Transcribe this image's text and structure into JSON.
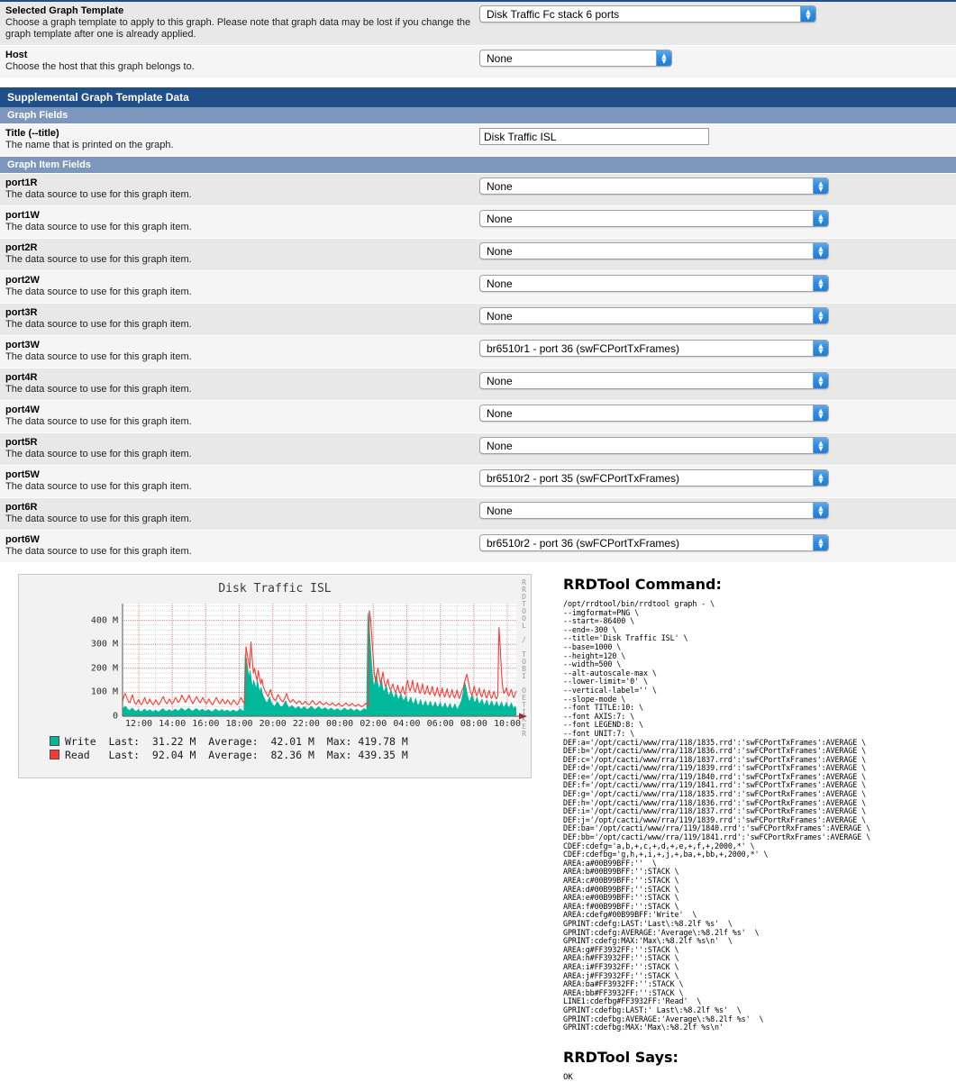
{
  "form": {
    "selected_template": {
      "name": "Selected Graph Template",
      "desc": "Choose a graph template to apply to this graph. Please note that graph data may be lost if you change the graph template after one is already applied.",
      "value": "Disk Traffic Fc stack 6 ports"
    },
    "host": {
      "name": "Host",
      "desc": "Choose the host that this graph belongs to.",
      "value": "None"
    }
  },
  "sections": {
    "supplemental": "Supplemental Graph Template Data",
    "graph_fields": "Graph Fields",
    "graph_item_fields": "Graph Item Fields"
  },
  "title_field": {
    "name": "Title (--title)",
    "desc": "The name that is printed on the graph.",
    "value": "Disk Traffic ISL"
  },
  "item_desc": "The data source to use for this graph item.",
  "items": [
    {
      "name": "port1R",
      "value": "None"
    },
    {
      "name": "port1W",
      "value": "None"
    },
    {
      "name": "port2R",
      "value": "None"
    },
    {
      "name": "port2W",
      "value": "None"
    },
    {
      "name": "port3R",
      "value": "None"
    },
    {
      "name": "port3W",
      "value": "br6510r1 - port 36 (swFCPortTxFrames)"
    },
    {
      "name": "port4R",
      "value": "None"
    },
    {
      "name": "port4W",
      "value": "None"
    },
    {
      "name": "port5R",
      "value": "None"
    },
    {
      "name": "port5W",
      "value": "br6510r2 - port 35 (swFCPortTxFrames)"
    },
    {
      "name": "port6R",
      "value": "None"
    },
    {
      "name": "port6W",
      "value": "br6510r2 - port 36 (swFCPortTxFrames)"
    }
  ],
  "rrdtool": {
    "command_heading": "RRDTool Command:",
    "says_heading": "RRDTool Says:",
    "says_body": "OK",
    "command": "/opt/rrdtool/bin/rrdtool graph - \\\n--imgformat=PNG \\\n--start=-86400 \\\n--end=-300 \\\n--title='Disk Traffic ISL' \\\n--base=1000 \\\n--height=120 \\\n--width=500 \\\n--alt-autoscale-max \\\n--lower-limit='0' \\\n--vertical-label='' \\\n--slope-mode \\\n--font TITLE:10: \\\n--font AXIS:7: \\\n--font LEGEND:8: \\\n--font UNIT:7: \\\nDEF:a='/opt/cacti/www/rra/118/1835.rrd':'swFCPortTxFrames':AVERAGE \\\nDEF:b='/opt/cacti/www/rra/118/1836.rrd':'swFCPortTxFrames':AVERAGE \\\nDEF:c='/opt/cacti/www/rra/118/1837.rrd':'swFCPortTxFrames':AVERAGE \\\nDEF:d='/opt/cacti/www/rra/119/1839.rrd':'swFCPortTxFrames':AVERAGE \\\nDEF:e='/opt/cacti/www/rra/119/1840.rrd':'swFCPortTxFrames':AVERAGE \\\nDEF:f='/opt/cacti/www/rra/119/1841.rrd':'swFCPortTxFrames':AVERAGE \\\nDEF:g='/opt/cacti/www/rra/118/1835.rrd':'swFCPortRxFrames':AVERAGE \\\nDEF:h='/opt/cacti/www/rra/118/1836.rrd':'swFCPortRxFrames':AVERAGE \\\nDEF:i='/opt/cacti/www/rra/118/1837.rrd':'swFCPortRxFrames':AVERAGE \\\nDEF:j='/opt/cacti/www/rra/119/1839.rrd':'swFCPortRxFrames':AVERAGE \\\nDEF:ba='/opt/cacti/www/rra/119/1840.rrd':'swFCPortRxFrames':AVERAGE \\\nDEF:bb='/opt/cacti/www/rra/119/1841.rrd':'swFCPortRxFrames':AVERAGE \\\nCDEF:cdefg='a,b,+,c,+,d,+,e,+,f,+,2000,*' \\\nCDEF:cdefbg='g,h,+,i,+,j,+,ba,+,bb,+,2000,*' \\\nAREA:a#00B99BFF:''  \\\nAREA:b#00B99BFF:'':STACK \\\nAREA:c#00B99BFF:'':STACK \\\nAREA:d#00B99BFF:'':STACK \\\nAREA:e#00B99BFF:'':STACK \\\nAREA:f#00B99BFF:'':STACK \\\nAREA:cdefg#00B99BFF:'Write'  \\\nGPRINT:cdefg:LAST:'Last\\:%8.2lf %s'  \\\nGPRINT:cdefg:AVERAGE:'Average\\:%8.2lf %s'  \\\nGPRINT:cdefg:MAX:'Max\\:%8.2lf %s\\n'  \\\nAREA:g#FF3932FF:'':STACK \\\nAREA:h#FF3932FF:'':STACK \\\nAREA:i#FF3932FF:'':STACK \\\nAREA:j#FF3932FF:'':STACK \\\nAREA:ba#FF3932FF:'':STACK \\\nAREA:bb#FF3932FF:'':STACK \\\nLINE1:cdefbg#FF3932FF:'Read'  \\\nGPRINT:cdefbg:LAST:' Last\\:%8.2lf %s'  \\\nGPRINT:cdefbg:AVERAGE:'Average\\:%8.2lf %s'  \\\nGPRINT:cdefbg:MAX:'Max\\:%8.2lf %s\\n'"
  },
  "chart_data": {
    "type": "area",
    "title": "Disk Traffic ISL",
    "xlabel": "",
    "ylabel": "",
    "watermark": "RRDTOOL / TOBI OETIKER",
    "grid": true,
    "legend_position": "bottom",
    "ylim": [
      0,
      470000000
    ],
    "yticks": [
      0,
      100000000,
      200000000,
      300000000,
      400000000
    ],
    "ytick_labels": [
      "0",
      "100 M",
      "200 M",
      "300 M",
      "400 M"
    ],
    "xtick_labels": [
      "12:00",
      "14:00",
      "16:00",
      "18:00",
      "20:00",
      "22:00",
      "00:00",
      "02:00",
      "04:00",
      "06:00",
      "08:00",
      "10:00"
    ],
    "legend": [
      {
        "name": "Write",
        "color": "#00B99B",
        "last_label": "Last:",
        "last": "31.22 M",
        "average_label": "Average:",
        "average": "42.01 M",
        "max_label": "Max:",
        "max": "419.78 M"
      },
      {
        "name": "Read",
        "color": "#FF3932",
        "last_label": "Last:",
        "last": "92.04 M",
        "average_label": "Average:",
        "average": "82.36 M",
        "max_label": "Max:",
        "max": "439.35 M"
      }
    ],
    "series": [
      {
        "name": "Write",
        "color": "#00B99B",
        "fill": true,
        "values": [
          28,
          35,
          42,
          38,
          30,
          26,
          24,
          30,
          34,
          28,
          22,
          20,
          24,
          28,
          22,
          18,
          20,
          26,
          30,
          24,
          20,
          22,
          28,
          24,
          20,
          18,
          22,
          26,
          22,
          18,
          20,
          24,
          28,
          32,
          26,
          22,
          20,
          24,
          28,
          24,
          20,
          22,
          26,
          30,
          26,
          22,
          24,
          28,
          34,
          30,
          26,
          22,
          26,
          30,
          34,
          28,
          24,
          20,
          24,
          28,
          32,
          28,
          24,
          22,
          26,
          30,
          26,
          22,
          20,
          24,
          28,
          24,
          20,
          18,
          22,
          26,
          30,
          26,
          22,
          20,
          24,
          28,
          24,
          20,
          22,
          26,
          24,
          20,
          18,
          22,
          26,
          24,
          20,
          18,
          22,
          26,
          30,
          26,
          22,
          20,
          260,
          240,
          200,
          160,
          190,
          150,
          120,
          150,
          130,
          110,
          150,
          120,
          100,
          120,
          95,
          80,
          70,
          60,
          55,
          70,
          80,
          60,
          50,
          45,
          40,
          50,
          60,
          55,
          45,
          40,
          38,
          45,
          55,
          65,
          50,
          40,
          35,
          40,
          45,
          40,
          35,
          30,
          35,
          40,
          38,
          32,
          30,
          35,
          40,
          35,
          30,
          28,
          32,
          38,
          42,
          36,
          30,
          28,
          32,
          36,
          40,
          34,
          30,
          28,
          32,
          36,
          32,
          28,
          26,
          30,
          34,
          30,
          26,
          24,
          28,
          32,
          28,
          24,
          22,
          26,
          30,
          34,
          30,
          26,
          24,
          28,
          32,
          28,
          24,
          22,
          26,
          30,
          26,
          22,
          20,
          24,
          28,
          32,
          28,
          24,
          430,
          380,
          300,
          220,
          150,
          120,
          150,
          180,
          140,
          110,
          130,
          160,
          120,
          100,
          110,
          130,
          100,
          85,
          95,
          110,
          90,
          75,
          85,
          100,
          80,
          70,
          80,
          95,
          75,
          65,
          70,
          85,
          65,
          55,
          65,
          80,
          60,
          50,
          60,
          75,
          55,
          45,
          55,
          70,
          50,
          42,
          52,
          65,
          48,
          40,
          50,
          62,
          46,
          38,
          48,
          60,
          44,
          36,
          46,
          58,
          42,
          34,
          44,
          56,
          40,
          32,
          42,
          54,
          38,
          30,
          40,
          52,
          36,
          28,
          38,
          50,
          60,
          80,
          110,
          140,
          120,
          90,
          70,
          60,
          75,
          90,
          70,
          55,
          65,
          80,
          60,
          50,
          60,
          72,
          55,
          45,
          55,
          68,
          50,
          42,
          52,
          64,
          48,
          40,
          50,
          62,
          46,
          38,
          48,
          60,
          44,
          36,
          46,
          58,
          42,
          34,
          44,
          56,
          40,
          32,
          42,
          30
        ]
      },
      {
        "name": "Read",
        "color": "#FF3932",
        "fill": false,
        "values": [
          62,
          80,
          95,
          85,
          70,
          60,
          56,
          75,
          90,
          70,
          55,
          50,
          60,
          70,
          58,
          48,
          52,
          66,
          78,
          62,
          52,
          56,
          72,
          62,
          52,
          48,
          58,
          68,
          58,
          48,
          52,
          62,
          72,
          82,
          68,
          58,
          52,
          62,
          72,
          62,
          52,
          56,
          68,
          78,
          68,
          58,
          62,
          72,
          88,
          78,
          68,
          58,
          68,
          78,
          88,
          72,
          62,
          52,
          62,
          72,
          82,
          72,
          62,
          56,
          68,
          78,
          68,
          58,
          52,
          62,
          72,
          62,
          52,
          48,
          58,
          68,
          78,
          68,
          58,
          52,
          62,
          72,
          62,
          52,
          56,
          68,
          62,
          52,
          48,
          58,
          68,
          62,
          52,
          48,
          58,
          68,
          78,
          68,
          58,
          52,
          290,
          260,
          230,
          200,
          310,
          240,
          180,
          200,
          170,
          150,
          190,
          160,
          135,
          155,
          125,
          110,
          100,
          90,
          82,
          100,
          112,
          88,
          76,
          70,
          64,
          78,
          90,
          82,
          70,
          64,
          60,
          70,
          82,
          95,
          76,
          64,
          58,
          64,
          70,
          64,
          58,
          52,
          58,
          64,
          60,
          52,
          50,
          56,
          62,
          56,
          50,
          48,
          52,
          60,
          66,
          58,
          50,
          48,
          52,
          58,
          62,
          54,
          50,
          48,
          52,
          58,
          52,
          48,
          46,
          50,
          56,
          50,
          46,
          44,
          48,
          54,
          48,
          44,
          42,
          46,
          50,
          56,
          50,
          46,
          44,
          48,
          54,
          48,
          44,
          42,
          46,
          50,
          46,
          42,
          40,
          44,
          48,
          54,
          48,
          44,
          440,
          400,
          330,
          250,
          175,
          145,
          175,
          200,
          165,
          135,
          155,
          185,
          145,
          125,
          135,
          155,
          125,
          110,
          120,
          135,
          115,
          100,
          110,
          130,
          105,
          95,
          105,
          125,
          100,
          90,
          130,
          150,
          120,
          105,
          125,
          150,
          115,
          100,
          115,
          140,
          110,
          95,
          110,
          135,
          105,
          92,
          108,
          128,
          100,
          90,
          105,
          125,
          98,
          85,
          100,
          120,
          95,
          82,
          98,
          118,
          92,
          80,
          95,
          115,
          90,
          78,
          92,
          112,
          88,
          76,
          90,
          110,
          86,
          74,
          88,
          108,
          118,
          140,
          160,
          175,
          150,
          120,
          100,
          88,
          105,
          125,
          100,
          85,
          98,
          118,
          92,
          80,
          95,
          112,
          88,
          76,
          92,
          108,
          85,
          74,
          88,
          104,
          82,
          72,
          86,
          370,
          290,
          180,
          120,
          95,
          105,
          118,
          95,
          85,
          98,
          112,
          88,
          78,
          92,
          105
        ]
      }
    ]
  }
}
